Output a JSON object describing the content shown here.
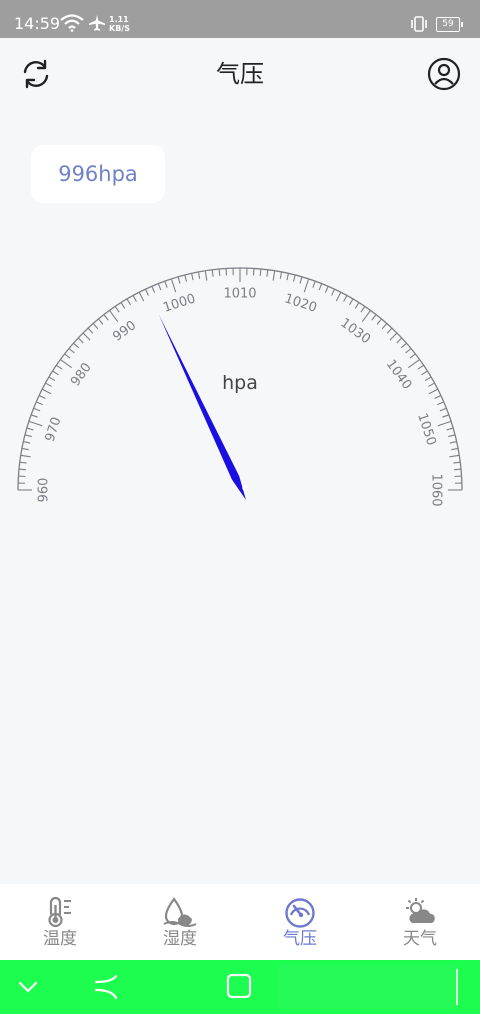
{
  "status_bar": {
    "time": "14:59",
    "net_speed_value": "1.11",
    "net_speed_unit": "KB/S",
    "battery": "59"
  },
  "header": {
    "title": "气压"
  },
  "reading": {
    "value_text": "996hpa",
    "pressure": 996
  },
  "gauge": {
    "unit_label": "hpa",
    "min": 960,
    "max": 1060,
    "major_step": 10,
    "minor_step": 1,
    "tick_labels": [
      "960",
      "970",
      "980",
      "990",
      "1000",
      "1010",
      "1020",
      "1030",
      "1040",
      "1050",
      "1060"
    ],
    "needle_color": "#1a0ee0",
    "tick_color": "#7a8088"
  },
  "tabs": [
    {
      "label": "温度",
      "icon": "thermometer-icon",
      "active": false
    },
    {
      "label": "湿度",
      "icon": "humidity-drop-icon",
      "active": false
    },
    {
      "label": "气压",
      "icon": "gauge-icon",
      "active": true
    },
    {
      "label": "天气",
      "icon": "weather-sun-cloud-icon",
      "active": false
    }
  ],
  "colors": {
    "accent": "#6d79cf",
    "inactive": "#888888",
    "status_bar": "#9e9e9e",
    "nav_bar": "#1cfd4f"
  }
}
